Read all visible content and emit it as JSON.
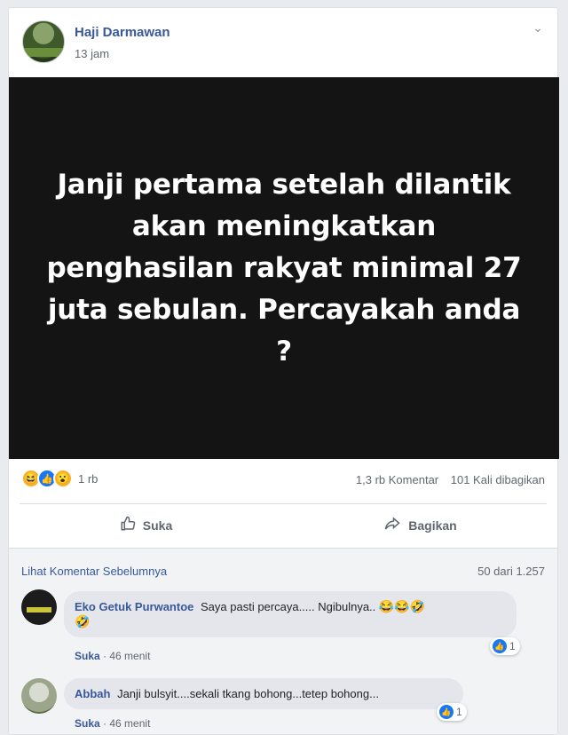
{
  "post": {
    "author": "Haji Darmawan",
    "time": "13 jam",
    "image_text": "Janji pertama setelah dilantik akan meningkatkan penghasilan rakyat minimal 27 juta sebulan. Percayakah anda ?"
  },
  "stats": {
    "reaction_icons": [
      "haha-icon",
      "like-icon",
      "wow-icon"
    ],
    "reaction_count": "1 rb",
    "comments": "1,3 rb Komentar",
    "shares": "101 Kali dibagikan"
  },
  "actions": {
    "like_label": "Suka",
    "share_label": "Bagikan"
  },
  "comments_section": {
    "view_previous": "Lihat Komentar Sebelumnya",
    "count": "50 dari 1.257",
    "items": [
      {
        "name": "Eko Getuk Purwantoe",
        "text": "Saya pasti percaya..... Ngibulnya..",
        "emojis": "😂😂🤣",
        "emoji2": "🤣",
        "reactions": "1",
        "like_label": "Suka",
        "time": "46 menit"
      },
      {
        "name": "Abbah",
        "text": "Janji bulsyit....sekali tkang bohong...tetep bohong...",
        "reactions": "1",
        "like_label": "Suka",
        "time": "46 menit"
      }
    ]
  },
  "colors": {
    "link": "#385898",
    "image_bg": "#141414",
    "like_blue": "#1877f2"
  }
}
